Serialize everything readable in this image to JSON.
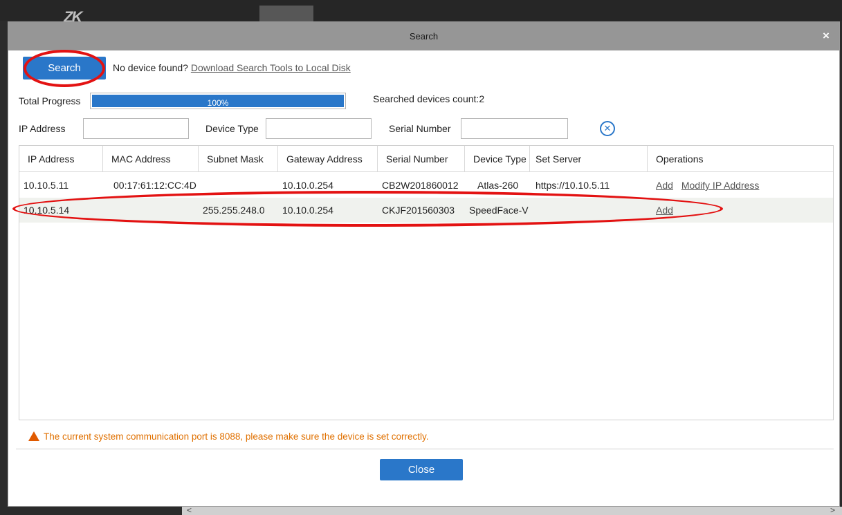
{
  "app": {
    "logo": "ZK"
  },
  "dialog": {
    "title": "Search",
    "close_glyph": "×"
  },
  "search": {
    "button_label": "Search",
    "no_device_text": "No device found?",
    "download_link": "Download Search Tools to Local Disk"
  },
  "progress": {
    "label": "Total Progress",
    "value_text": "100%",
    "value": 100,
    "count_text": "Searched devices count:2"
  },
  "filters": {
    "ip_label": "IP Address",
    "ip_value": "",
    "type_label": "Device Type",
    "type_value": "",
    "serial_label": "Serial Number",
    "serial_value": "",
    "clear_glyph": "✕"
  },
  "table": {
    "columns": [
      "IP Address",
      "MAC Address",
      "Subnet Mask",
      "Gateway Address",
      "Serial Number",
      "Device Type",
      "Set Server",
      "Operations"
    ],
    "rows": [
      {
        "ip": "10.10.5.11",
        "mac": "00:17:61:12:CC:4D",
        "subnet": "",
        "gateway": "10.10.0.254",
        "serial": "CB2W201860012",
        "type": "Atlas-260",
        "server": "https://10.10.5.11",
        "ops": [
          "Add",
          "Modify IP Address"
        ]
      },
      {
        "ip": "10.10.5.14",
        "mac": "",
        "subnet": "255.255.248.0",
        "gateway": "10.10.0.254",
        "serial": "CKJF201560303",
        "type": "SpeedFace-V",
        "server": "",
        "ops": [
          "Add"
        ]
      }
    ]
  },
  "warning": "The current system communication port is 8088, please make sure the device is set correctly.",
  "footer": {
    "close_label": "Close"
  },
  "scroll": {
    "left_glyph": "<",
    "right_glyph": ">"
  },
  "colors": {
    "accent": "#2a77c9",
    "annotation": "#e31212",
    "warning": "#e07000",
    "titlebar": "#969696"
  }
}
